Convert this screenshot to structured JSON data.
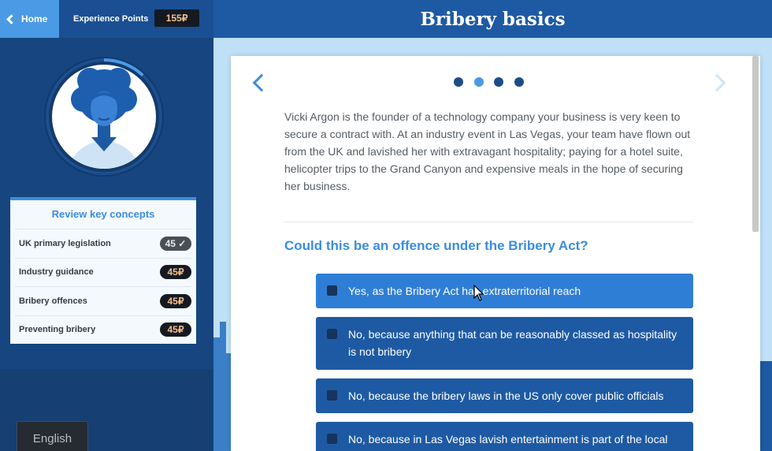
{
  "header": {
    "home_label": "Home",
    "xp_label": "Experience Points",
    "xp_value": "155₽",
    "title": "Bribery basics"
  },
  "sidebar": {
    "concepts_title": "Review key concepts",
    "concepts": [
      {
        "label": "UK primary legislation",
        "value": "45 ✓",
        "completed": true
      },
      {
        "label": "Industry guidance",
        "value": "45₽",
        "completed": false
      },
      {
        "label": "Bribery offences",
        "value": "45₽",
        "completed": false
      },
      {
        "label": "Preventing bribery",
        "value": "45₽",
        "completed": false
      }
    ],
    "language": "English",
    "progress_ring_fraction": 0.12
  },
  "slide": {
    "dots": [
      false,
      true,
      false,
      false
    ],
    "story": "Vicki Argon is the founder of a technology company your business is very keen to secure a contract with. At an industry event in Las Vegas, your team have flown out from the UK and lavished her with extravagant hospitality; paying for a hotel suite, helicopter trips to the Grand Canyon and expensive meals in the hope of securing her business.",
    "question": "Could this be an offence under the Bribery Act?",
    "options": [
      "Yes, as the Bribery Act has extraterritorial reach",
      "No, because anything that can be reasonably classed as hospitality is not bribery",
      "No, because the bribery laws in the US only cover public officials",
      "No, because in Las Vegas lavish entertainment is part of the local"
    ]
  },
  "colors": {
    "accent": "#3a8de0",
    "header_bg": "#1e5aa3",
    "sidebar_bg": "#17457f",
    "option_bg": "#1e5aa3",
    "option_hover_bg": "#2f7ed6"
  }
}
